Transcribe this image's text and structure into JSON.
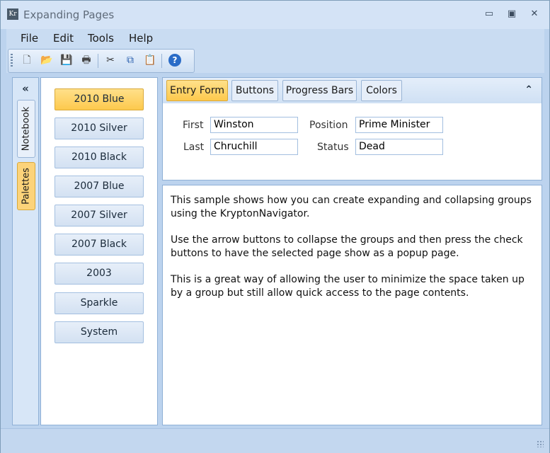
{
  "window": {
    "title": "Expanding Pages",
    "app_icon_text": "Kr",
    "minimize": "▭",
    "restore": "▣",
    "close": "✕"
  },
  "menu": [
    "File",
    "Edit",
    "Tools",
    "Help"
  ],
  "toolbar": {
    "icons": [
      "new-icon",
      "open-icon",
      "save-icon",
      "print-icon",
      "cut-icon",
      "copy-icon",
      "paste-icon",
      "help-icon"
    ],
    "glyphs": {
      "new": "🗋",
      "open": "📂",
      "save": "💾",
      "print": "🖶",
      "cut": "✂",
      "copy": "⧉",
      "paste": "📋",
      "help": "?"
    }
  },
  "side": {
    "collapse_glyph": "«",
    "tabs": [
      "Notebook",
      "Palettes"
    ],
    "active_tab": "Palettes"
  },
  "palettes": {
    "items": [
      "2010 Blue",
      "2010 Silver",
      "2010 Black",
      "2007 Blue",
      "2007 Silver",
      "2007 Black",
      "2003",
      "Sparkle",
      "System"
    ],
    "selected": "2010 Blue"
  },
  "navigator": {
    "tabs": [
      "Entry Form",
      "Buttons",
      "Progress Bars",
      "Colors"
    ],
    "active_tab": "Entry Form",
    "collapse_glyph": "⌃"
  },
  "form": {
    "first_label": "First",
    "first_value": "Winston",
    "last_label": "Last",
    "last_value": "Chruchill",
    "position_label": "Position",
    "position_value": "Prime Minister",
    "status_label": "Status",
    "status_value": "Dead"
  },
  "description": [
    "This sample shows how you can create expanding and collapsing groups using the KryptonNavigator.",
    "Use the arrow buttons to collapse the groups and then press the check buttons to have the selected page show as a popup page.",
    "This is a great way of allowing the user to minimize the space taken up by a group but still allow quick access to the page contents."
  ],
  "colors": {
    "accent": "#fdc94d",
    "panel_border": "#8fb0d6",
    "chrome": "#bcd3ee"
  }
}
